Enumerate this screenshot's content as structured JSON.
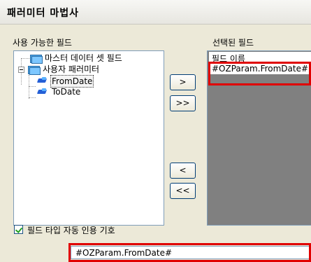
{
  "window": {
    "title": "패러미터 마법사"
  },
  "available_fields": {
    "label": "사용 가능한 필드",
    "tree": [
      {
        "label": "마스터 데이터 셋 필드",
        "icon": "folder-icon"
      },
      {
        "label": "사용자 패러미터",
        "icon": "folder-icon",
        "expanded": true,
        "children": [
          {
            "label": "FromDate",
            "icon": "parameter-icon",
            "selected": true
          },
          {
            "label": "ToDate",
            "icon": "parameter-icon"
          }
        ]
      }
    ]
  },
  "buttons": {
    "add": ">",
    "add_all": ">>",
    "remove": "<",
    "remove_all": "<<"
  },
  "selected_fields": {
    "label": "선택된 필드",
    "header": "필드 이름",
    "items": [
      "#OZParam.FromDate#"
    ]
  },
  "options": {
    "auto_quote_label": "필드 타입 자동 인용 기호",
    "auto_quote_checked": true
  },
  "expression_field": {
    "value": "#OZParam.FromDate#"
  },
  "colors": {
    "highlight_border": "#e00000",
    "dialog_bg": "#ece9d8",
    "list_bg": "#808080"
  }
}
